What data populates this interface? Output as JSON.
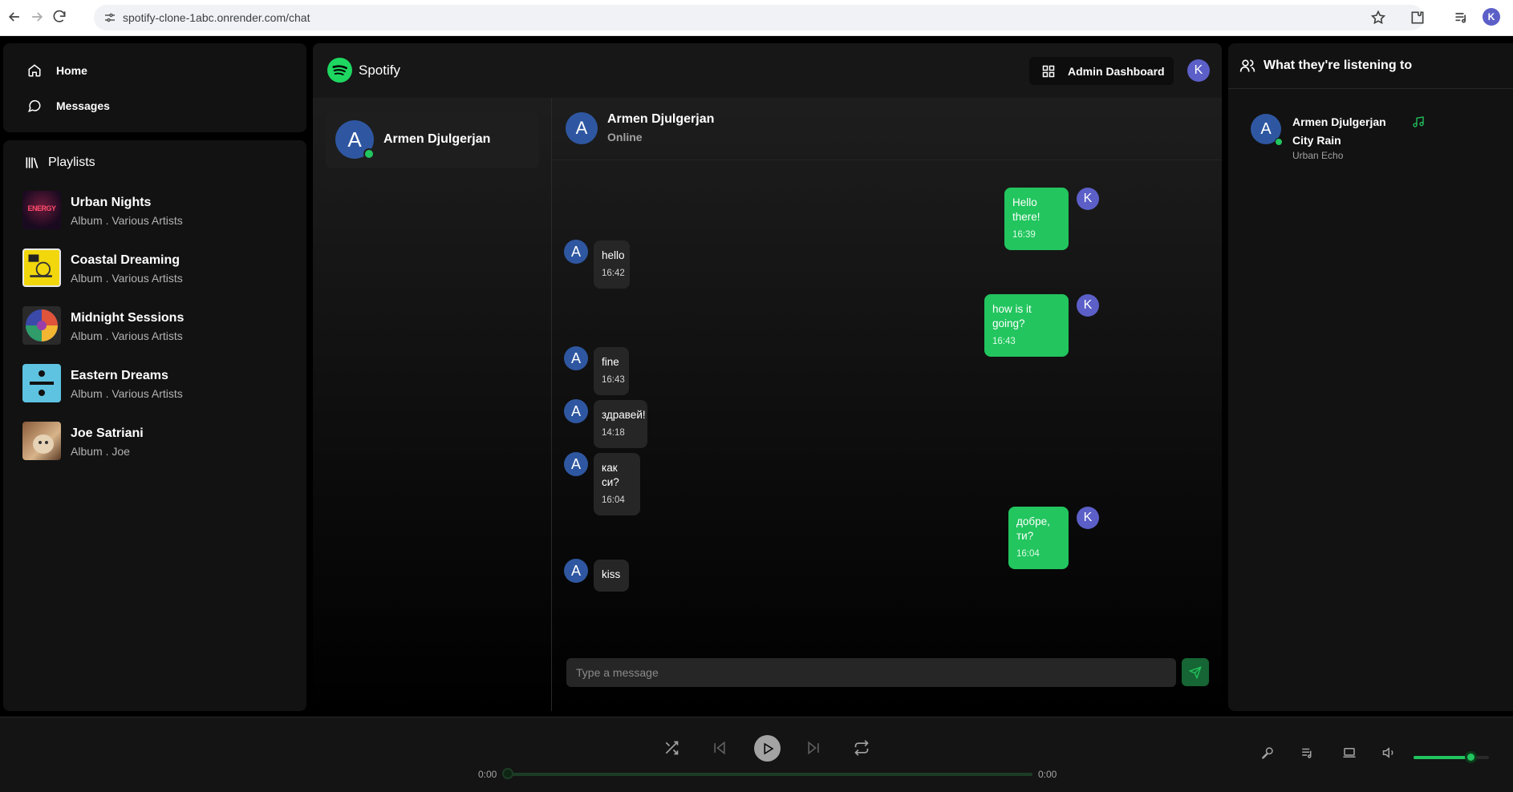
{
  "browser": {
    "url": "spotify-clone-1abc.onrender.com/chat",
    "profile_initial": "K"
  },
  "sidebar": {
    "nav": [
      {
        "label": "Home",
        "icon": "home-icon"
      },
      {
        "label": "Messages",
        "icon": "message-circle-icon"
      }
    ],
    "library_title": "Playlists",
    "playlists": [
      {
        "title": "Urban Nights",
        "subtitle": "Album . Various Artists",
        "cover_text": "ENERGY"
      },
      {
        "title": "Coastal Dreaming",
        "subtitle": "Album . Various Artists"
      },
      {
        "title": "Midnight Sessions",
        "subtitle": "Album . Various Artists"
      },
      {
        "title": "Eastern Dreams",
        "subtitle": "Album . Various Artists"
      },
      {
        "title": "Joe Satriani",
        "subtitle": "Album . Joe"
      }
    ]
  },
  "header": {
    "brand": "Spotify",
    "admin_label": "Admin Dashboard",
    "user_initial": "K"
  },
  "chat": {
    "users": [
      {
        "initial": "A",
        "name": "Armen Djulgerjan",
        "online": true
      }
    ],
    "active_user": {
      "initial": "A",
      "name": "Armen Djulgerjan",
      "status": "Online"
    },
    "messages": [
      {
        "from": "me",
        "initial": "K",
        "text": "Hello there!",
        "time": "16:39"
      },
      {
        "from": "them",
        "initial": "A",
        "text": "hello",
        "time": "16:42"
      },
      {
        "from": "me",
        "initial": "K",
        "text": "how is it going?",
        "time": "16:43"
      },
      {
        "from": "them",
        "initial": "A",
        "text": "fine",
        "time": "16:43"
      },
      {
        "from": "them",
        "initial": "A",
        "text": "здравей!",
        "time": "14:18"
      },
      {
        "from": "them",
        "initial": "A",
        "text": "как си?",
        "time": "16:04"
      },
      {
        "from": "me",
        "initial": "K",
        "text": "добре, ти?",
        "time": "16:04"
      },
      {
        "from": "them",
        "initial": "A",
        "text": "kiss",
        "time": ""
      }
    ],
    "composer_placeholder": "Type a message"
  },
  "friends": {
    "title": "What they're listening to",
    "items": [
      {
        "initial": "A",
        "name": "Armen Djulgerjan",
        "song": "City Rain",
        "artist": "Urban Echo",
        "online": true
      }
    ]
  },
  "player": {
    "time_current": "0:00",
    "time_total": "0:00",
    "progress": 0,
    "volume": 0.75
  },
  "colors": {
    "accent": "#22c55e",
    "avatar_blue": "#2f57a1",
    "avatar_purple": "#5b5fc7",
    "panel": "#121212"
  }
}
